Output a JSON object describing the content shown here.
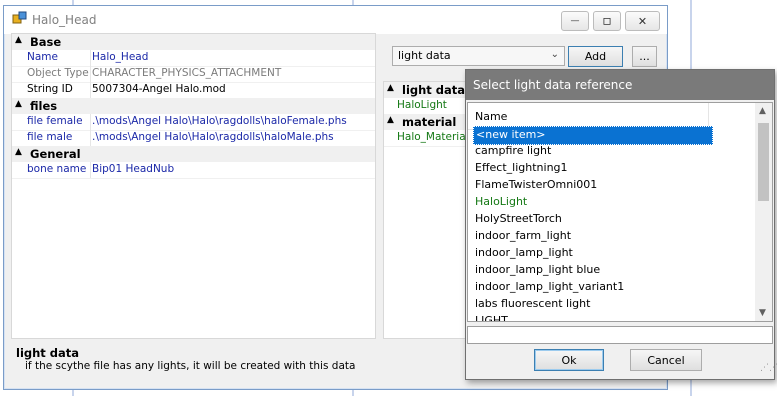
{
  "window": {
    "title": "Halo_Head",
    "minimize_glyph": "—",
    "restore_glyph": "▫",
    "close_glyph": "✕"
  },
  "property_grid": {
    "categories": [
      {
        "label": "Base",
        "rows": [
          {
            "key": "Name",
            "value": "Halo_Head"
          },
          {
            "key": "Object Type",
            "value": "CHARACTER_PHYSICS_ATTACHMENT"
          },
          {
            "key": "String ID",
            "value": "5007304-Angel Halo.mod"
          }
        ]
      },
      {
        "label": "files",
        "rows": [
          {
            "key": "file female",
            "value": ".\\mods\\Angel Halo\\Halo\\ragdolls\\haloFemale.phs"
          },
          {
            "key": "file male",
            "value": ".\\mods\\Angel Halo\\Halo\\ragdolls\\haloMale.phs"
          }
        ]
      },
      {
        "label": "General",
        "rows": [
          {
            "key": "bone name",
            "value": "Bip01 HeadNub"
          }
        ]
      }
    ],
    "description": {
      "title": "light data",
      "text": "if the scythe file has any lights, it will be created with this data"
    }
  },
  "references": {
    "combo_value": "light data",
    "add_label": "Add",
    "more_label": "...",
    "grid": [
      {
        "category": "light data",
        "item": "HaloLight"
      },
      {
        "category": "material",
        "item": "Halo_Material"
      }
    ]
  },
  "dialog": {
    "title": "Select light data reference",
    "column_header": "Name",
    "items": [
      "<new item>",
      "campfire light",
      "Effect_lightning1",
      "FlameTwisterOmni001",
      "HaloLight",
      "HolyStreetTorch",
      "indoor_farm_light",
      "indoor_lamp_light",
      "indoor_lamp_light blue",
      "indoor_lamp_light_variant1",
      "labs fluorescent light",
      "LIGHT"
    ],
    "selected_index": 0,
    "highlight_index": 4,
    "search_value": "",
    "ok_label": "Ok",
    "cancel_label": "Cancel"
  },
  "colors": {
    "selection": "#0a72d2",
    "link_blue": "#1b28a8",
    "green_item": "#147814",
    "dialog_title_bg": "#7a7a7a"
  }
}
